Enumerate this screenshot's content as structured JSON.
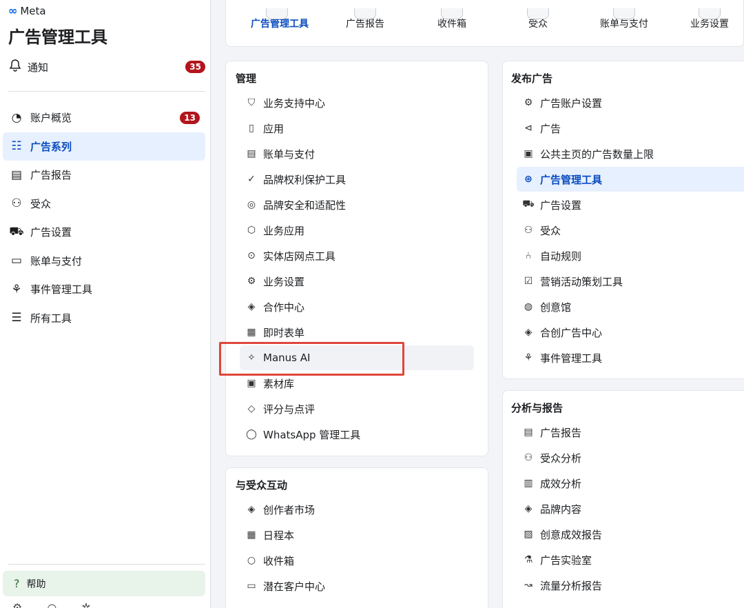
{
  "sidebar": {
    "brand": "Meta",
    "brand_logo": "∞",
    "title": "广告管理工具",
    "notification": {
      "label": "通知",
      "count": "35"
    },
    "nav": [
      {
        "label": "账户概览",
        "icon": "dashboard-icon",
        "badge": "13"
      },
      {
        "label": "广告系列",
        "icon": "campaign-table-icon",
        "active": true
      },
      {
        "label": "广告报告",
        "icon": "report-icon"
      },
      {
        "label": "受众",
        "icon": "audience-icon"
      },
      {
        "label": "广告设置",
        "icon": "ad-settings-icon"
      },
      {
        "label": "账单与支付",
        "icon": "credit-card-icon"
      },
      {
        "label": "事件管理工具",
        "icon": "events-icon"
      },
      {
        "label": "所有工具",
        "icon": "menu-icon"
      }
    ],
    "help": "帮助"
  },
  "topbar": {
    "tabs": [
      {
        "label": "广告管理工具",
        "active": true
      },
      {
        "label": "广告报告"
      },
      {
        "label": "收件箱"
      },
      {
        "label": "受众"
      },
      {
        "label": "账单与支付"
      },
      {
        "label": "业务设置"
      }
    ]
  },
  "panels": {
    "manage": {
      "title": "管理",
      "items": [
        {
          "label": "业务支持中心",
          "icon": "shield-heart-icon"
        },
        {
          "label": "应用",
          "icon": "phone-icon"
        },
        {
          "label": "账单与支付",
          "icon": "receipt-icon"
        },
        {
          "label": "品牌权利保护工具",
          "icon": "badge-check-icon"
        },
        {
          "label": "品牌安全和适配性",
          "icon": "shield-icon"
        },
        {
          "label": "业务应用",
          "icon": "cube-icon"
        },
        {
          "label": "实体店网点工具",
          "icon": "location-pin-icon"
        },
        {
          "label": "业务设置",
          "icon": "gear-icon"
        },
        {
          "label": "合作中心",
          "icon": "handshake-icon"
        },
        {
          "label": "即时表单",
          "icon": "form-icon"
        },
        {
          "label": "Manus AI",
          "icon": "sparkle-hand-icon"
        },
        {
          "label": "素材库",
          "icon": "image-library-icon"
        },
        {
          "label": "评分与点评",
          "icon": "tag-icon"
        },
        {
          "label": "WhatsApp 管理工具",
          "icon": "whatsapp-icon"
        }
      ]
    },
    "engage": {
      "title": "与受众互动",
      "items": [
        {
          "label": "创作者市场",
          "icon": "handshake-icon"
        },
        {
          "label": "日程本",
          "icon": "calendar-icon"
        },
        {
          "label": "收件箱",
          "icon": "chat-bubble-icon"
        },
        {
          "label": "潜在客户中心",
          "icon": "contact-card-icon"
        }
      ]
    },
    "publish": {
      "title": "发布广告",
      "items": [
        {
          "label": "广告账户设置",
          "icon": "account-settings-icon"
        },
        {
          "label": "广告",
          "icon": "megaphone-icon"
        },
        {
          "label": "公共主页的广告数量上限",
          "icon": "page-limit-icon"
        },
        {
          "label": "广告管理工具",
          "icon": "compass-icon",
          "active": true
        },
        {
          "label": "广告设置",
          "icon": "ad-settings-icon"
        },
        {
          "label": "受众",
          "icon": "audience-icon"
        },
        {
          "label": "自动规则",
          "icon": "rules-icon"
        },
        {
          "label": "营销活动策划工具",
          "icon": "planner-icon"
        },
        {
          "label": "创意馆",
          "icon": "palette-icon"
        },
        {
          "label": "合创广告中心",
          "icon": "handshake-icon"
        },
        {
          "label": "事件管理工具",
          "icon": "events-icon"
        }
      ]
    },
    "analyze": {
      "title": "分析与报告",
      "items": [
        {
          "label": "广告报告",
          "icon": "report-icon"
        },
        {
          "label": "受众分析",
          "icon": "audience-icon"
        },
        {
          "label": "成效分析",
          "icon": "bar-chart-icon"
        },
        {
          "label": "品牌内容",
          "icon": "handshake-icon"
        },
        {
          "label": "创意成效报告",
          "icon": "image-report-icon"
        },
        {
          "label": "广告实验室",
          "icon": "flask-icon"
        },
        {
          "label": "流量分析报告",
          "icon": "trend-line-icon"
        }
      ]
    }
  }
}
